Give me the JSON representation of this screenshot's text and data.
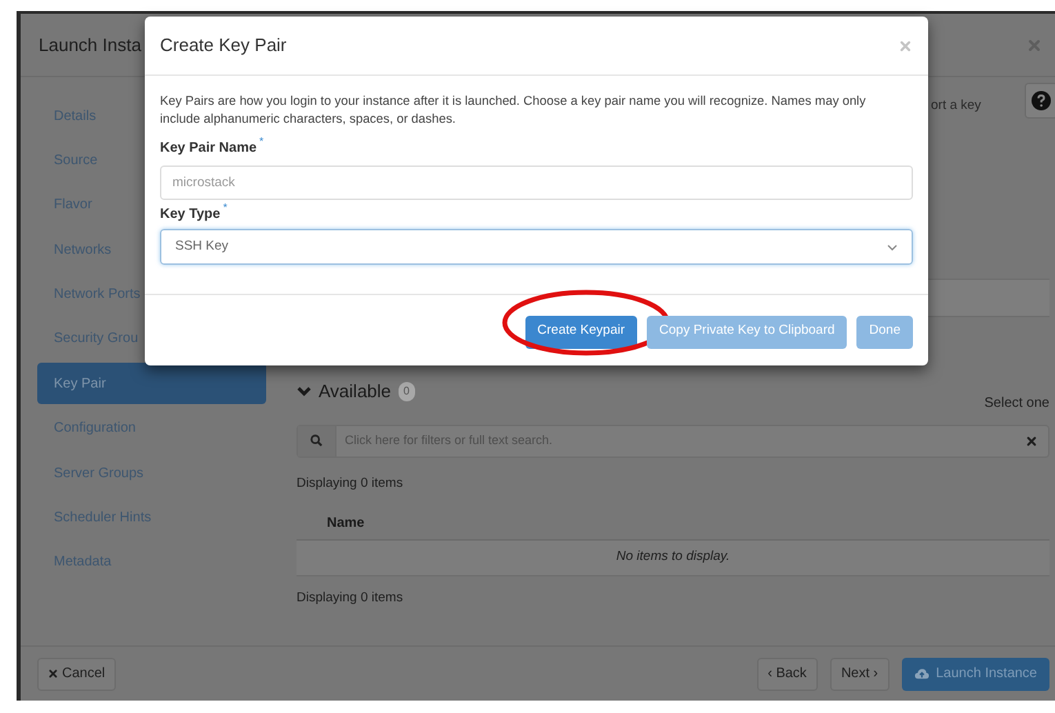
{
  "window": {
    "title": "Launch Insta"
  },
  "sidebar": {
    "items": [
      {
        "label": "Details",
        "selected": false
      },
      {
        "label": "Source",
        "selected": false
      },
      {
        "label": "Flavor",
        "selected": false
      },
      {
        "label": "Networks",
        "selected": false
      },
      {
        "label": "Network Ports",
        "selected": false
      },
      {
        "label": "Security Grou",
        "selected": false
      },
      {
        "label": "Key Pair",
        "selected": true
      },
      {
        "label": "Configuration",
        "selected": false
      },
      {
        "label": "Server Groups",
        "selected": false
      },
      {
        "label": "Scheduler Hints",
        "selected": false
      },
      {
        "label": "Metadata",
        "selected": false
      }
    ]
  },
  "content": {
    "partial_text": "ort a key",
    "available": {
      "title": "Available",
      "count": "0",
      "hint": "Select one"
    },
    "search": {
      "placeholder": "Click here for filters or full text search."
    },
    "displaying_top": "Displaying 0 items",
    "table": {
      "columns": [
        "Name"
      ],
      "empty_message": "No items to display."
    },
    "displaying_bottom": "Displaying 0 items"
  },
  "footer": {
    "cancel": "Cancel",
    "back": "‹ Back",
    "next": "Next ›",
    "launch": "Launch Instance"
  },
  "modal": {
    "title": "Create Key Pair",
    "description": "Key Pairs are how you login to your instance after it is launched. Choose a key pair name you will recognize. Names may only include alphanumeric characters, spaces, or dashes.",
    "fields": [
      {
        "kind": "text",
        "label": "Key Pair Name",
        "required_mark": "*",
        "placeholder": "microstack"
      },
      {
        "kind": "select",
        "label": "Key Type",
        "required_mark": "*",
        "value": "SSH Key",
        "focused": true
      }
    ],
    "buttons": [
      {
        "label": "Create Keypair",
        "disabled": false,
        "highlighted": true
      },
      {
        "label": "Copy Private Key to Clipboard",
        "disabled": true,
        "highlighted": false
      },
      {
        "label": "Done",
        "disabled": true,
        "highlighted": false
      }
    ]
  }
}
